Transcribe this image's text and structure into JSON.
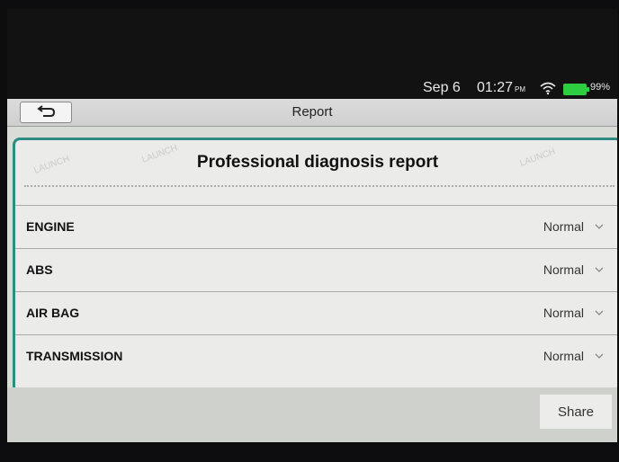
{
  "status_bar": {
    "date": "Sep 6",
    "time": "01:27",
    "ampm": "PM",
    "wifi_icon": "wifi-icon",
    "battery_percent": "99%"
  },
  "title_bar": {
    "title": "Report",
    "back_icon": "back-arrow-icon"
  },
  "report": {
    "heading": "Professional diagnosis report",
    "watermark": "LAUNCH",
    "systems": [
      {
        "name": "ENGINE",
        "status": "Normal"
      },
      {
        "name": "ABS",
        "status": "Normal"
      },
      {
        "name": "AIR BAG",
        "status": "Normal"
      },
      {
        "name": "TRANSMISSION",
        "status": "Normal"
      }
    ]
  },
  "bottom_bar": {
    "share_label": "Share"
  },
  "colors": {
    "accent": "#2f8c82",
    "battery": "#2ecc40"
  }
}
